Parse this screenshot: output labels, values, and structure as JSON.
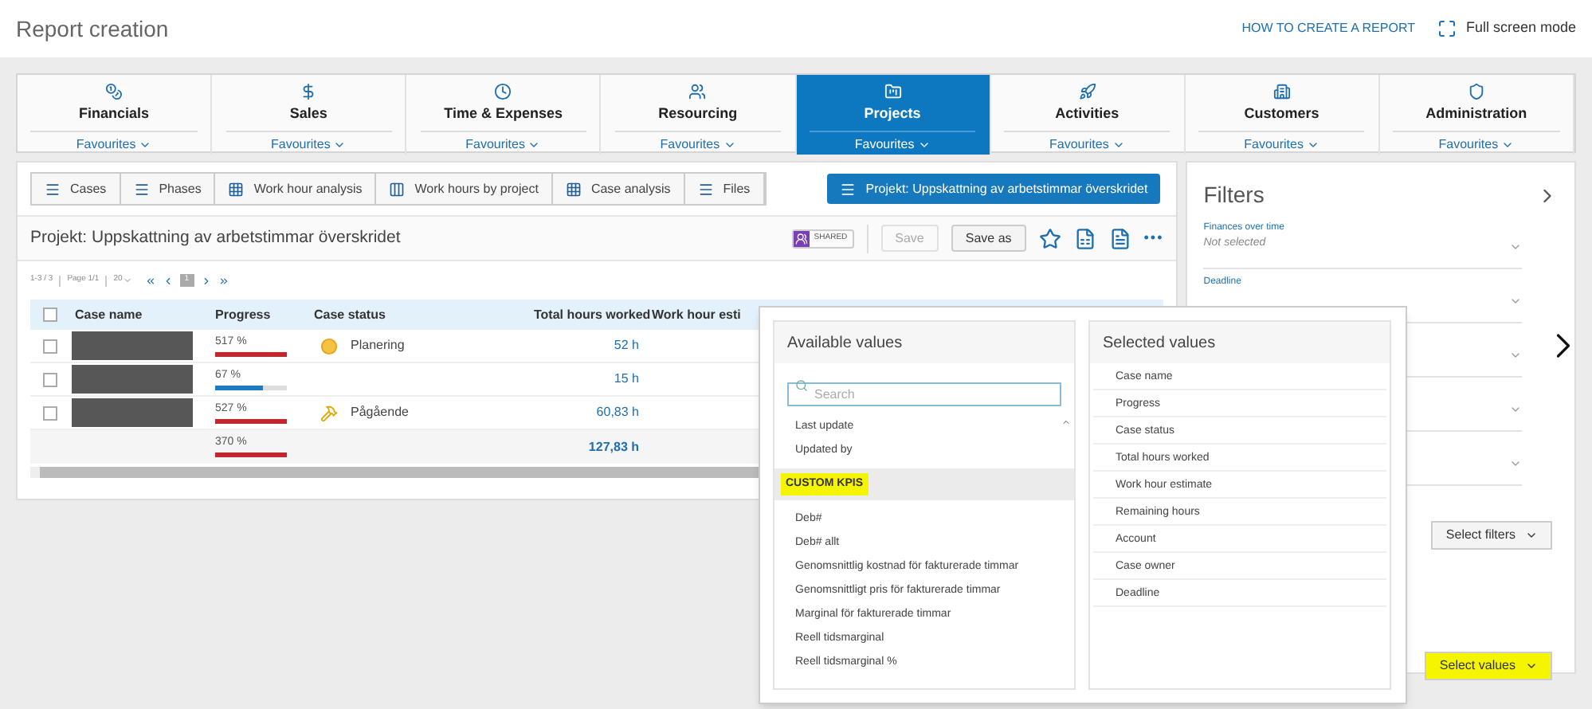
{
  "header": {
    "title": "Report creation",
    "help_link": "HOW TO CREATE A REPORT",
    "fullscreen": "Full screen mode"
  },
  "nav_tabs": [
    {
      "label": "Financials",
      "sub": "Favourites",
      "selected": false
    },
    {
      "label": "Sales",
      "sub": "Favourites",
      "selected": false
    },
    {
      "label": "Time & Expenses",
      "sub": "Favourites",
      "selected": false
    },
    {
      "label": "Resourcing",
      "sub": "Favourites",
      "selected": false
    },
    {
      "label": "Projects",
      "sub": "Favourites",
      "selected": true
    },
    {
      "label": "Activities",
      "sub": "Favourites",
      "selected": false
    },
    {
      "label": "Customers",
      "sub": "Favourites",
      "selected": false
    },
    {
      "label": "Administration",
      "sub": "Favourites",
      "selected": false
    }
  ],
  "report_types": [
    "Cases",
    "Phases",
    "Work hour analysis",
    "Work hours by project",
    "Case analysis",
    "Files"
  ],
  "current_report_button": "Projekt: Uppskattning av arbetstimmar överskridet",
  "report": {
    "title": "Projekt: Uppskattning av arbetstimmar överskridet",
    "shared_badge": "SHARED",
    "save": {
      "label": "Save",
      "disabled": true
    },
    "save_as": {
      "label": "Save as",
      "disabled": false
    },
    "more": "•••"
  },
  "pagination": {
    "range": "1-3 / 3",
    "page": "Page 1/1",
    "page_size": "20",
    "current": "1"
  },
  "table": {
    "select_all_checked": false,
    "columns": [
      "Case name",
      "Progress",
      "Case status",
      "Total hours worked",
      "Work hour esti"
    ],
    "rows": [
      {
        "checked": false,
        "progress": "517 %",
        "level": 1,
        "color": "#c0282d",
        "status": "Planering",
        "hours": "52 h"
      },
      {
        "checked": false,
        "progress": "67 %",
        "level": 0.67,
        "color": "#1f7bc1",
        "hours": "15 h"
      },
      {
        "checked": false,
        "progress": "527 %",
        "level": 1,
        "color": "#c0282d",
        "status": "Pågående",
        "hours": "60,83 h"
      }
    ],
    "total": {
      "progress": "370 %",
      "level": 1,
      "color": "#c0282d",
      "hours": "127,83 h"
    }
  },
  "filters": {
    "title": "Filters",
    "items": [
      {
        "label": "Finances over time",
        "value": "Not selected"
      },
      {
        "label": "Deadline"
      }
    ],
    "select_filters": "Select filters",
    "select_values": {
      "label": "Select values",
      "highlighted": true
    }
  },
  "value_picker": {
    "available_title": "Available values",
    "search_placeholder": "Search",
    "available": [
      {
        "kind": "item",
        "label": "Last update"
      },
      {
        "kind": "item",
        "label": "Updated by"
      },
      {
        "kind": "group",
        "label": "CUSTOM KPIS",
        "highlighted": true
      },
      {
        "kind": "item",
        "label": "Deb#"
      },
      {
        "kind": "item",
        "label": "Deb# allt"
      },
      {
        "kind": "item",
        "label": "Genomsnittlig kostnad för fakturerade timmar"
      },
      {
        "kind": "item",
        "label": "Genomsnittligt pris för fakturerade timmar"
      },
      {
        "kind": "item",
        "label": "Marginal för fakturerade timmar"
      },
      {
        "kind": "item",
        "label": "Reell tidsmarginal"
      },
      {
        "kind": "item",
        "label": "Reell tidsmarginal %"
      }
    ],
    "selected_title": "Selected values",
    "selected": [
      "Case name",
      "Progress",
      "Case status",
      "Total hours worked",
      "Work hour estimate",
      "Remaining hours",
      "Account",
      "Case owner",
      "Deadline"
    ]
  }
}
